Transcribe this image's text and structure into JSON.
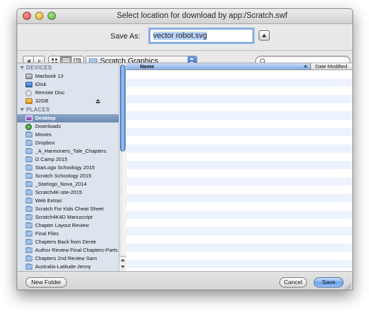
{
  "window": {
    "title": "Select location for download by app:/Scratch.swf"
  },
  "save_as": {
    "label": "Save As:",
    "value": "vector robot.svg"
  },
  "toolbar": {
    "location": "Scratch Graphics",
    "search_placeholder": ""
  },
  "sidebar": {
    "devices_header": "DEVICES",
    "devices": [
      {
        "label": "Macbook 13",
        "icon": "hard-disk-icon"
      },
      {
        "label": "iDisk",
        "icon": "idisk-icon"
      },
      {
        "label": "Remote Disc",
        "icon": "disc-icon"
      },
      {
        "label": "32GB",
        "icon": "usb-drive-icon",
        "ejectable": true
      }
    ],
    "places_header": "PLACES",
    "places": [
      {
        "label": "Desktop",
        "icon": "desktop-icon",
        "selected": true
      },
      {
        "label": "Downloads",
        "icon": "downloads-icon"
      },
      {
        "label": "Movies",
        "icon": "folder-icon"
      },
      {
        "label": "Dropbox",
        "icon": "folder-icon"
      },
      {
        "label": "_A_Harmoners_Tale_Chapters",
        "icon": "folder-icon"
      },
      {
        "label": "i2 Camp 2015",
        "icon": "folder-icon"
      },
      {
        "label": "StarLogo Schoology 2015",
        "icon": "folder-icon"
      },
      {
        "label": "Scratch Schoology 2015",
        "icon": "folder-icon"
      },
      {
        "label": "_Starlogo_Nova_2014",
        "icon": "folder-icon"
      },
      {
        "label": "Scratch4K-site-2015",
        "icon": "folder-icon"
      },
      {
        "label": "Web Extras",
        "icon": "folder-icon"
      },
      {
        "label": "Scratch For Kids Cheat Sheet",
        "icon": "folder-icon"
      },
      {
        "label": "Scratch4K4D Manuscript",
        "icon": "folder-icon"
      },
      {
        "label": "Chapter Layout Review",
        "icon": "folder-icon"
      },
      {
        "label": "Final Files",
        "icon": "folder-icon"
      },
      {
        "label": "Chapters Back from Derek",
        "icon": "folder-icon"
      },
      {
        "label": "Author Review Final Chapters-Parts",
        "icon": "folder-icon"
      },
      {
        "label": "Chapters 2nd Review Sam",
        "icon": "folder-icon"
      },
      {
        "label": "Australia-Latitude-Jenny",
        "icon": "folder-icon"
      }
    ]
  },
  "file_list": {
    "columns": [
      "Name",
      "Date Modified"
    ],
    "rows": []
  },
  "buttons": {
    "new_folder": "New Folder",
    "cancel": "Cancel",
    "save": "Save"
  },
  "colors": {
    "accent": "#6fa3ee",
    "sidebar_bg": "#dde4ee",
    "selection": "#7a93bd"
  }
}
